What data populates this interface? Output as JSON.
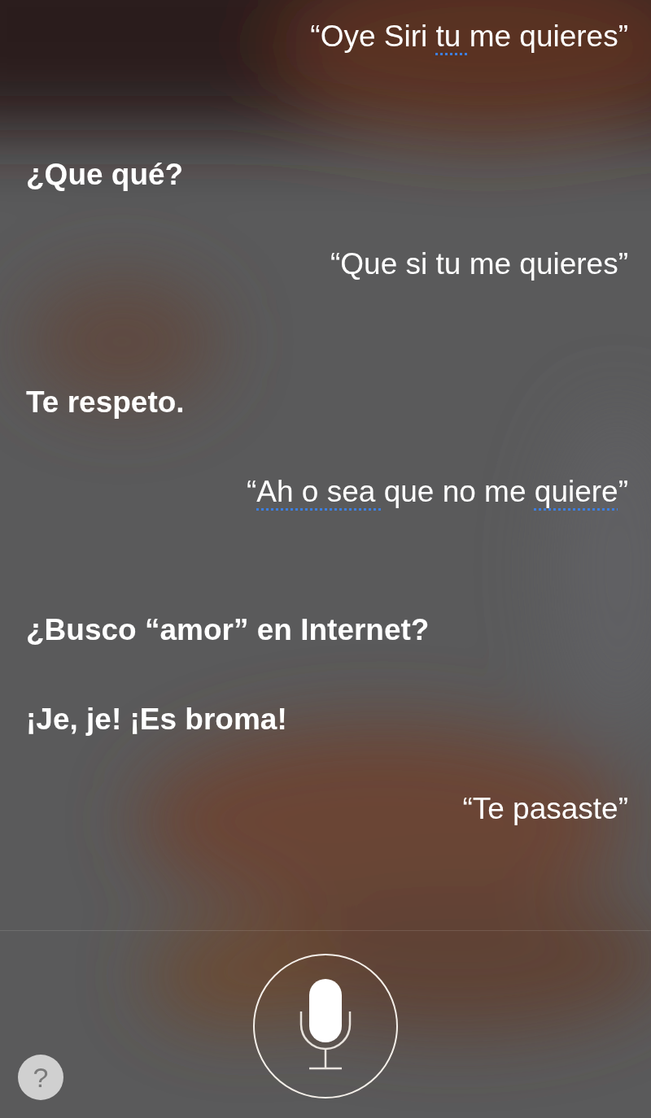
{
  "messages": [
    {
      "kind": "user",
      "parts": [
        {
          "text": "“Oye Siri ",
          "flagged": false
        },
        {
          "text": "tu ",
          "flagged": true
        },
        {
          "text": "me quieres”",
          "flagged": false
        }
      ]
    },
    {
      "kind": "siri",
      "parts": [
        {
          "text": "¿Que qué?",
          "flagged": false
        }
      ]
    },
    {
      "kind": "user",
      "parts": [
        {
          "text": "“Que si tu me quieres”",
          "flagged": false
        }
      ]
    },
    {
      "kind": "siri",
      "parts": [
        {
          "text": "Te respeto.",
          "flagged": false
        }
      ]
    },
    {
      "kind": "user",
      "parts": [
        {
          "text": "“",
          "flagged": false
        },
        {
          "text": "Ah o sea ",
          "flagged": true
        },
        {
          "text": "que no me ",
          "flagged": false
        },
        {
          "text": "quiere",
          "flagged": true
        },
        {
          "text": "”",
          "flagged": false
        }
      ]
    },
    {
      "kind": "siri",
      "parts": [
        {
          "text": "¿Busco “amor” en Internet?",
          "flagged": false
        }
      ]
    },
    {
      "kind": "siri",
      "parts": [
        {
          "text": "¡Je, je! ¡Es broma!",
          "flagged": false
        }
      ]
    },
    {
      "kind": "user",
      "parts": [
        {
          "text": "“Te pasaste”",
          "flagged": false
        }
      ]
    }
  ],
  "help_button": {
    "label": "?"
  }
}
